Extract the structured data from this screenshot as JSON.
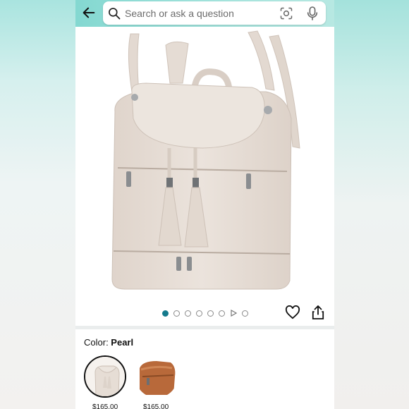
{
  "search": {
    "placeholder": "Search or ask a question",
    "icon": "search-icon",
    "camera_icon": "lens-camera-icon",
    "mic_icon": "mic-icon"
  },
  "header": {
    "back_icon": "back-arrow-icon"
  },
  "gallery": {
    "image_count": 7,
    "active_index": 0,
    "has_video": true,
    "heart_icon": "heart-icon",
    "share_icon": "share-icon"
  },
  "variant": {
    "label": "Color: ",
    "selected": "Pearl",
    "options": [
      {
        "name": "Pearl",
        "price": "$165.00"
      },
      {
        "name": "Brown",
        "price": "$165.00"
      }
    ]
  },
  "colors": {
    "accent_bar": "#84d8d1",
    "dot_active": "#147a8c",
    "bag": "#e6dcd4"
  }
}
